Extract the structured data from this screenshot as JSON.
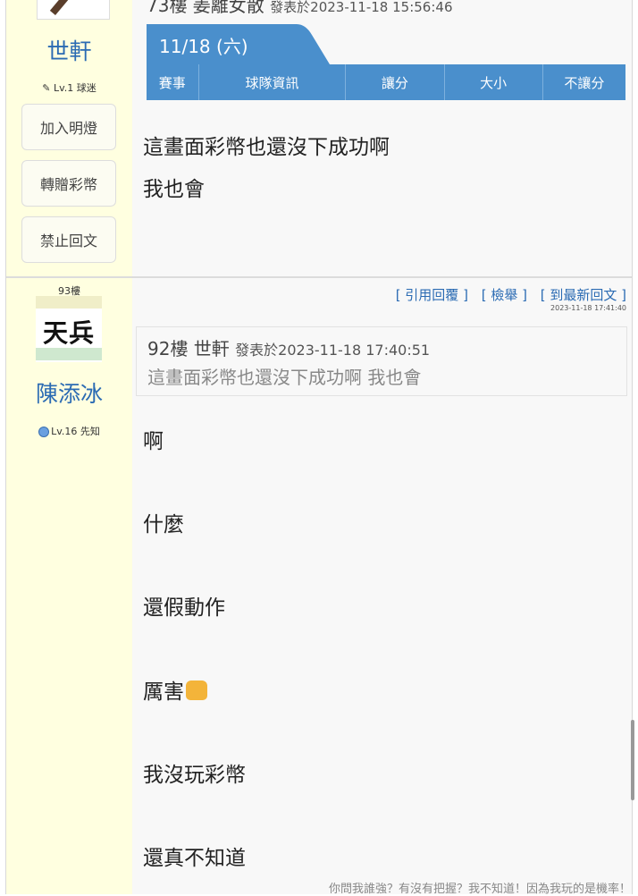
{
  "post1": {
    "author": {
      "name": "世軒",
      "level": "Lv.1 球迷"
    },
    "buttons": [
      "加入明燈",
      "轉贈彩幣",
      "禁止回文"
    ],
    "quote_header": {
      "floor_user": "73樓 姜離女散",
      "posted": "發表於2023-11-18 15:56:46"
    },
    "match_card": {
      "date": "11/18 (六)",
      "columns": [
        "賽事",
        "球隊資訊",
        "讓分",
        "大小",
        "不讓分"
      ],
      "accent": "#4a8fcc"
    },
    "body": [
      "這畫面彩幣也還沒下成功啊",
      "我也會"
    ]
  },
  "post2": {
    "floor": "93樓",
    "author": {
      "avatar_text": "天兵",
      "name": "陳添冰",
      "level": "Lv.16 先知"
    },
    "actions": [
      "[ 引用回覆 ]",
      "[ 檢舉 ]",
      "[ 到最新回文 ]"
    ],
    "timestamp": "2023-11-18 17:41:40",
    "quote": {
      "floor_user": "92樓 世軒",
      "posted": "發表於2023-11-18 17:40:51",
      "text": "這畫面彩幣也還沒下成功啊 我也會"
    },
    "body": [
      "啊",
      "什麼",
      "還假動作",
      "厲害",
      "我沒玩彩幣",
      "還真不知道"
    ],
    "signature": "你問我誰強？有沒有把握？我不知道！因為我玩的是機率！"
  }
}
